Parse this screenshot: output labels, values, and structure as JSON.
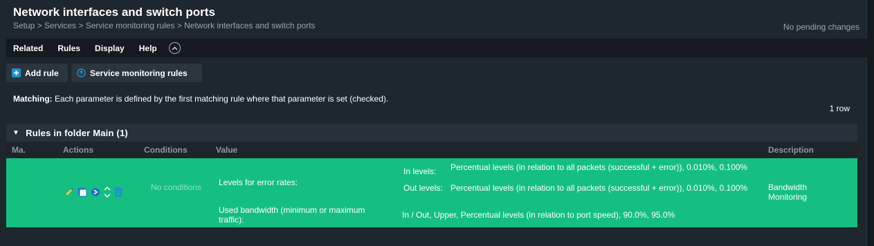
{
  "page": {
    "title": "Network interfaces and switch ports",
    "breadcrumb": "Setup > Services > Service monitoring rules > Network interfaces and switch ports",
    "pending_changes": "No pending changes"
  },
  "menu": {
    "items": [
      "Related",
      "Rules",
      "Display",
      "Help"
    ]
  },
  "toolbar": {
    "add_rule_label": "Add rule",
    "service_rules_label": "Service monitoring rules"
  },
  "matching": {
    "label": "Matching:",
    "text": " Each parameter is defined by the first matching rule where that parameter is set (checked)."
  },
  "row_count": "1 row",
  "folder": {
    "title": "Rules in folder Main (1)",
    "columns": [
      "Ma.",
      "Actions",
      "Conditions",
      "Value",
      "Description"
    ]
  },
  "rule": {
    "conditions": "No conditions",
    "error_rates_label": "Levels for error rates:",
    "in_levels_label": "In levels:",
    "in_levels_value": "Percentual levels (in relation to all packets (successful + error)), 0.010%, 0.100%",
    "out_levels_label": "Out levels:",
    "out_levels_value": "Percentual levels (in relation to all packets (successful + error)), 0.010%, 0.100%",
    "bandwidth_label": "Used bandwidth (minimum or maximum traffic):",
    "bandwidth_value": "In / Out, Upper, Percentual levels (in relation to port speed), 90.0%, 95.0%",
    "description": "Bandwidth Monitoring"
  },
  "colors": {
    "row_highlight": "#15bf81",
    "background": "#1e262e",
    "accent_blue": "#1e90d0"
  }
}
